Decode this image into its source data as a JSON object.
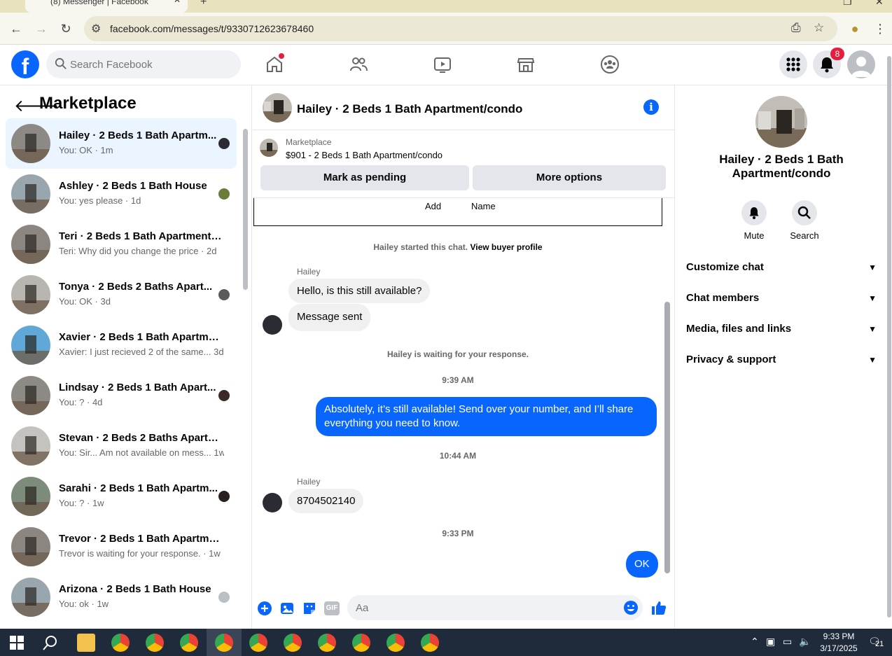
{
  "browser": {
    "tab_title": "(8) Messenger | Facebook",
    "url": "facebook.com/messages/t/9330712623678460"
  },
  "fb": {
    "search_placeholder": "Search Facebook",
    "notification_count": "8",
    "brand_color": "#0866ff"
  },
  "sidebar": {
    "back_icon": "arrow-left-icon",
    "title": "Marketplace",
    "conversations": [
      {
        "name": "Hailey · 2 Beds 1 Bath Apartm...",
        "preview": "You: OK · 1m",
        "active": true,
        "thumb": "#8d8a86",
        "mini": "#2b2b33"
      },
      {
        "name": "Ashley · 2 Beds 1 Bath House",
        "preview": "You: yes please · 1d",
        "active": false,
        "thumb": "#9aa6ad",
        "mini": "#6b7b3a"
      },
      {
        "name": "Teri · 2 Beds 1 Bath Apartment/c...",
        "preview": "Teri: Why did you change the price · 2d",
        "active": false,
        "thumb": "#8c8680",
        "mini": ""
      },
      {
        "name": "Tonya · 2 Beds 2 Baths Apart...",
        "preview": "You: OK · 3d",
        "active": false,
        "thumb": "#b9b6b1",
        "mini": "#5a5a5a"
      },
      {
        "name": "Xavier · 2 Beds 1 Bath Apartmen...",
        "preview": "Xavier: I just recieved 2 of the same... 3d",
        "active": false,
        "thumb": "#5fa8d8",
        "mini": ""
      },
      {
        "name": "Lindsay · 2 Beds 1 Bath Apart...",
        "preview": "You: ? · 4d",
        "active": false,
        "thumb": "#8d8a86",
        "mini": "#3a2a2a"
      },
      {
        "name": "Stevan · 2 Beds 2 Baths Apartme...",
        "preview": "You: Sir... Am not available on mess... 1w",
        "active": false,
        "thumb": "#c5c3bf",
        "mini": ""
      },
      {
        "name": "Sarahi · 2 Beds 1 Bath Apartm...",
        "preview": "You: ? · 1w",
        "active": false,
        "thumb": "#7c8b7a",
        "mini": "#2a2020"
      },
      {
        "name": "Trevor · 2 Beds 1 Bath Apartmen...",
        "preview": "Trevor is waiting for your response. · 1w",
        "active": false,
        "thumb": "#8c8680",
        "mini": ""
      },
      {
        "name": "Arizona · 2 Beds 1 Bath House",
        "preview": "You: ok · 1w",
        "active": false,
        "thumb": "#9aa6ad",
        "mini": "#bcc0c4"
      }
    ]
  },
  "chat": {
    "title": "Hailey · 2 Beds 1 Bath Apartment/condo",
    "listing_label": "Marketplace",
    "listing_detail": "$901 - 2 Beds 1 Bath Apartment/condo",
    "mark_pending_label": "Mark as pending",
    "more_options_label": "More options",
    "add_label": "Add",
    "name_label": "Name",
    "started_text": "Hailey started this chat.",
    "view_profile_link": "View buyer profile",
    "sender1": "Hailey",
    "msg1": "Hello, is this still available?",
    "msg2": "Message sent",
    "waiting_text": "Hailey is waiting for your response.",
    "time1": "9:39 AM",
    "msg3": "Absolutely, it’s still available! Send over your number, and I’ll share everything you need to know.",
    "time2": "10:44 AM",
    "sender2": "Hailey",
    "msg4": "8704502140",
    "time3": "9:33 PM",
    "msg5": "OK",
    "composer_placeholder": "Aa",
    "gif_label": "GIF"
  },
  "details": {
    "name": "Hailey · 2 Beds 1 Bath Apartment/condo",
    "mute_label": "Mute",
    "search_label": "Search",
    "sections": [
      "Customize chat",
      "Chat members",
      "Media, files and links",
      "Privacy & support"
    ]
  },
  "taskbar": {
    "time": "9:33 PM",
    "date": "3/17/2025",
    "notif_count": "21"
  }
}
